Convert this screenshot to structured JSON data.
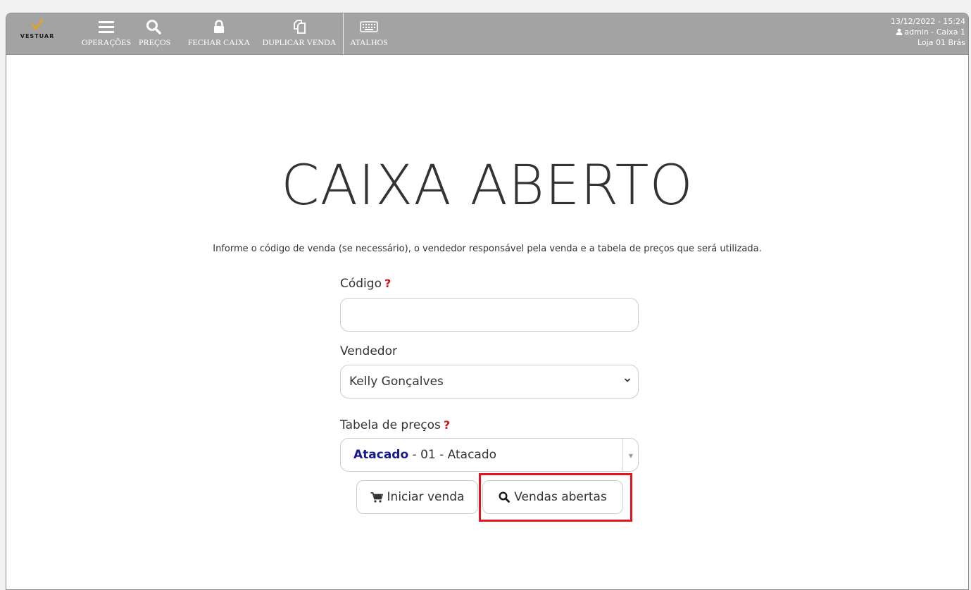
{
  "brand": {
    "name": "VESTUAR",
    "accent": "#f0a500"
  },
  "nav": {
    "items": [
      {
        "label": "OPERAÇÕES",
        "icon": "menu-icon"
      },
      {
        "label": "PREÇOS",
        "icon": "search-icon"
      },
      {
        "label": "FECHAR CAIXA",
        "icon": "lock-icon"
      },
      {
        "label": "DUPLICAR VENDA",
        "icon": "duplicate-icon"
      },
      {
        "label": "ATALHOS",
        "icon": "keyboard-icon"
      }
    ]
  },
  "status": {
    "datetime": "13/12/2022 - 15:24",
    "user": "admin - Caixa 1",
    "store": "Loja 01 Brás"
  },
  "main": {
    "title": "CAIXA ABERTO",
    "instructions": "Informe o código de venda (se necessário), o vendedor responsável pela venda e a tabela de preços que será utilizada."
  },
  "form": {
    "code": {
      "label": "Código",
      "help": "?",
      "value": ""
    },
    "seller": {
      "label": "Vendedor",
      "value": "Kelly Gonçalves"
    },
    "price_table": {
      "label": "Tabela de preços",
      "help": "?",
      "value_bold": "Atacado",
      "value_rest": " - 01 - Atacado"
    }
  },
  "actions": {
    "start_sale": "Iniciar venda",
    "open_sales": "Vendas abertas"
  },
  "colors": {
    "topbar": "#a3a3a3",
    "help": "#d9111b",
    "highlight": "#e3141e",
    "price_table_bold": "#1a1a8c"
  }
}
